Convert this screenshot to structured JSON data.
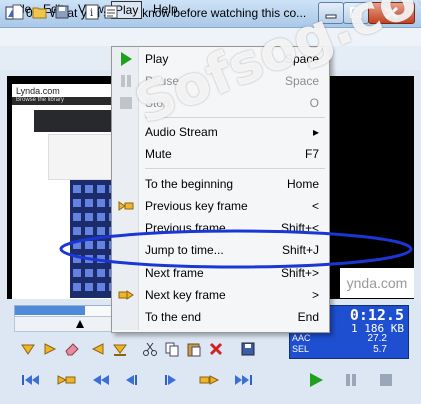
{
  "window": {
    "title": "002 What you should know before watching this co..."
  },
  "menubar": {
    "file": "File",
    "edit": "Edit",
    "view": "View",
    "play": "Play",
    "help": "Help"
  },
  "play_menu": {
    "play": {
      "label": "Play",
      "key": "Space"
    },
    "pause": {
      "label": "Pause",
      "key": "Space"
    },
    "stop": {
      "label": "Stop",
      "key": "O"
    },
    "audio_stream": {
      "label": "Audio Stream"
    },
    "mute": {
      "label": "Mute",
      "key": "F7"
    },
    "to_beginning": {
      "label": "To the beginning",
      "key": "Home"
    },
    "prev_key_frame": {
      "label": "Previous key frame",
      "key": "<"
    },
    "prev_frame": {
      "label": "Previous frame",
      "key": "Shift+<"
    },
    "jump_to_time": {
      "label": "Jump to time...",
      "key": "Shift+J"
    },
    "next_frame": {
      "label": "Next frame",
      "key": "Shift+>"
    },
    "next_key_frame": {
      "label": "Next key frame",
      "key": ">"
    },
    "to_end": {
      "label": "To the end",
      "key": "End"
    }
  },
  "video": {
    "site_logo": "Lynda.com",
    "banner": "Browse the library",
    "right_text": "ynda.com"
  },
  "status": {
    "time": "0:12.5",
    "size": "1 186 KB",
    "aac_label": "AAC",
    "aac_value": "27.2",
    "sel_label": "SEL",
    "sel_value": "5.7"
  },
  "watermark": "Sofsog.com",
  "accent_colors": {
    "oval": "#1a37d6",
    "info_panel": "#1e4fd0",
    "play_green": "#1fa11f"
  }
}
